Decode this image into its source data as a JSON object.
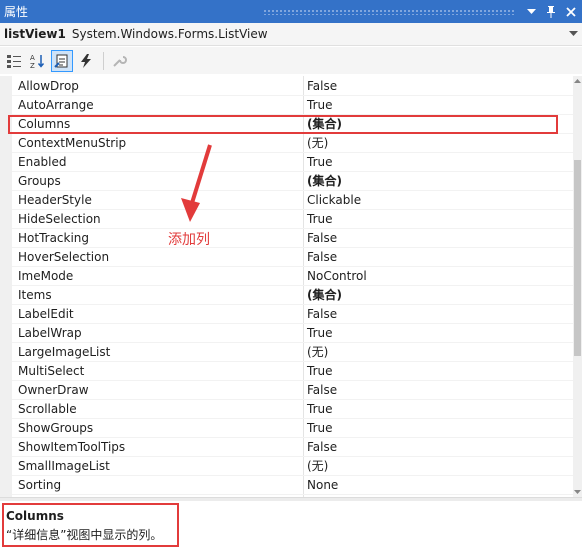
{
  "panel": {
    "title": "属性",
    "icons": {
      "dropdown": "chevron-down-icon",
      "pin": "pin-icon",
      "close": "close-icon"
    }
  },
  "object_selector": {
    "name": "listView1",
    "type": "System.Windows.Forms.ListView"
  },
  "toolbar": {
    "buttons": [
      {
        "icon": "categorized-icon",
        "active": false
      },
      {
        "icon": "alphabetical-icon",
        "active": false
      },
      {
        "icon": "properties-icon",
        "active": true
      },
      {
        "icon": "events-icon",
        "active": false
      },
      {
        "icon": "property-pages-icon",
        "active": false,
        "disabled": true
      }
    ]
  },
  "properties": [
    {
      "name": "AllowDrop",
      "value": "False"
    },
    {
      "name": "AutoArrange",
      "value": "True"
    },
    {
      "name": "Columns",
      "value": "(集合)",
      "bold": true
    },
    {
      "name": "ContextMenuStrip",
      "value": "(无)"
    },
    {
      "name": "Enabled",
      "value": "True"
    },
    {
      "name": "Groups",
      "value": "(集合)",
      "bold": true
    },
    {
      "name": "HeaderStyle",
      "value": "Clickable"
    },
    {
      "name": "HideSelection",
      "value": "True"
    },
    {
      "name": "HotTracking",
      "value": "False"
    },
    {
      "name": "HoverSelection",
      "value": "False"
    },
    {
      "name": "ImeMode",
      "value": "NoControl"
    },
    {
      "name": "Items",
      "value": "(集合)",
      "bold": true
    },
    {
      "name": "LabelEdit",
      "value": "False"
    },
    {
      "name": "LabelWrap",
      "value": "True"
    },
    {
      "name": "LargeImageList",
      "value": "(无)"
    },
    {
      "name": "MultiSelect",
      "value": "True"
    },
    {
      "name": "OwnerDraw",
      "value": "False"
    },
    {
      "name": "Scrollable",
      "value": "True"
    },
    {
      "name": "ShowGroups",
      "value": "True"
    },
    {
      "name": "ShowItemToolTips",
      "value": "False"
    },
    {
      "name": "SmallImageList",
      "value": "(无)"
    },
    {
      "name": "Sorting",
      "value": "None"
    }
  ],
  "description": {
    "name": "Columns",
    "text": "“详细信息”视图中显示的列。"
  },
  "annotation": {
    "label": "添加列",
    "color": "#e23b3b"
  },
  "colors": {
    "titlebar": "#3472c8",
    "highlight": "#e23b3b",
    "active_tool": "#cfe3f8"
  }
}
